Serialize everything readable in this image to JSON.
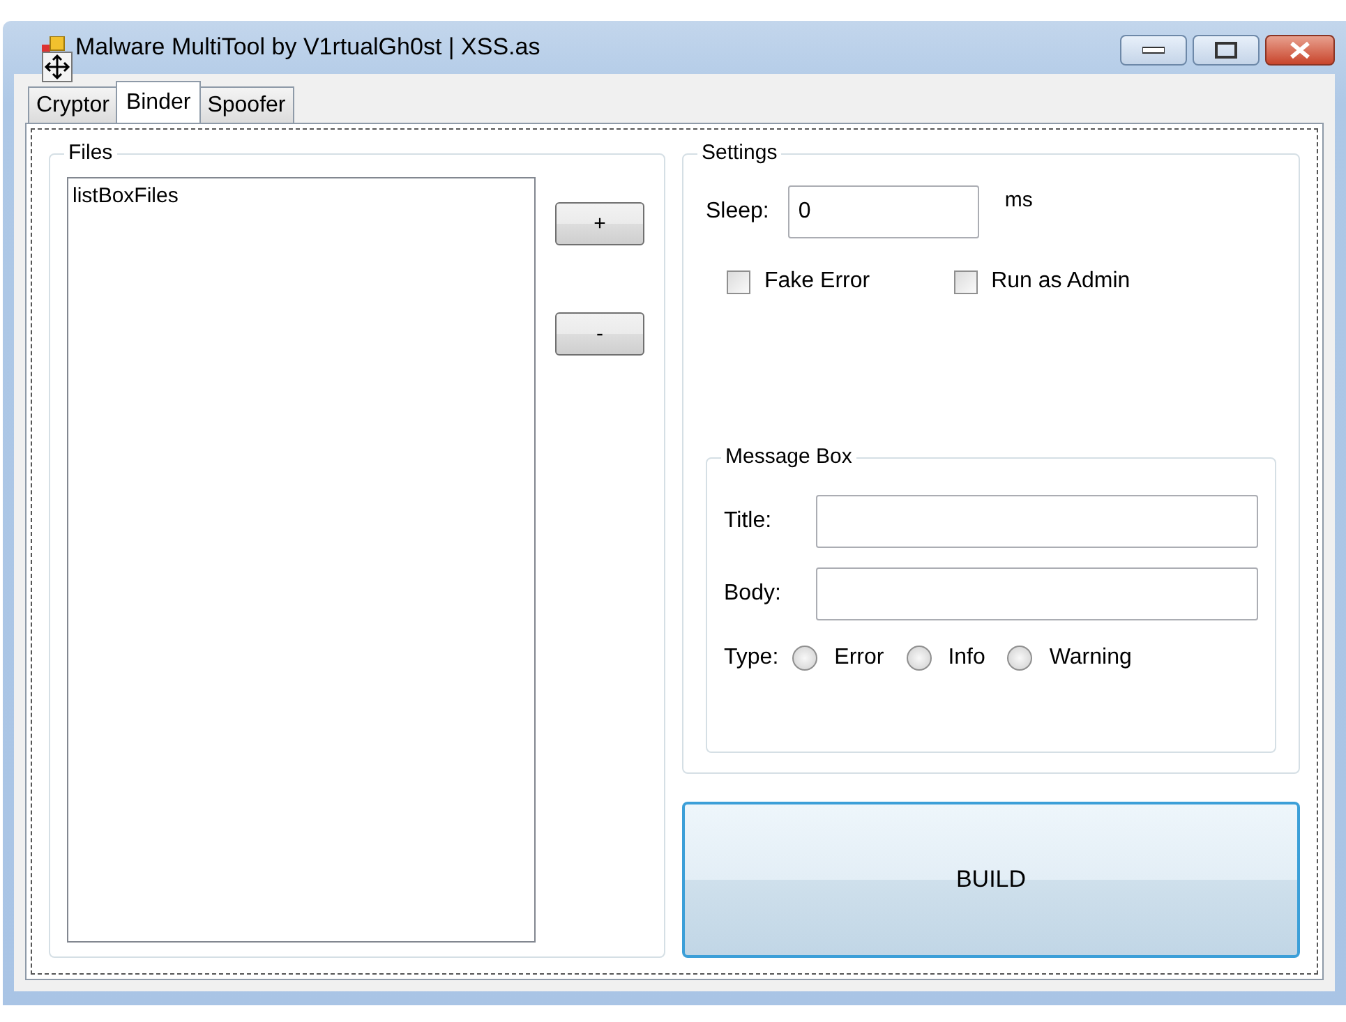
{
  "window": {
    "title": "Malware MultiTool by V1rtualGh0st | XSS.as"
  },
  "tabs": [
    {
      "label": "Cryptor",
      "selected": false
    },
    {
      "label": "Binder",
      "selected": true
    },
    {
      "label": "Spoofer",
      "selected": false
    }
  ],
  "files": {
    "title": "Files",
    "list_items": [
      "listBoxFiles"
    ],
    "buttons": [
      "+",
      "-"
    ]
  },
  "settings": {
    "title": "Settings",
    "sleep_label": "Sleep:",
    "sleep_value": "0",
    "sleep_unit": "ms",
    "options": [
      {
        "label": "Fake Error",
        "checked": false
      },
      {
        "label": "Run as Admin",
        "checked": false
      }
    ],
    "message_box": {
      "title": "Message Box",
      "fields": [
        {
          "label": "Title:"
        },
        {
          "label": "Body:"
        }
      ],
      "type_label": "Type:",
      "types": [
        {
          "label": "Error",
          "selected": false
        },
        {
          "label": "Info",
          "selected": false
        },
        {
          "label": "Warning",
          "selected": false
        }
      ]
    }
  },
  "build_button": "BUILD"
}
